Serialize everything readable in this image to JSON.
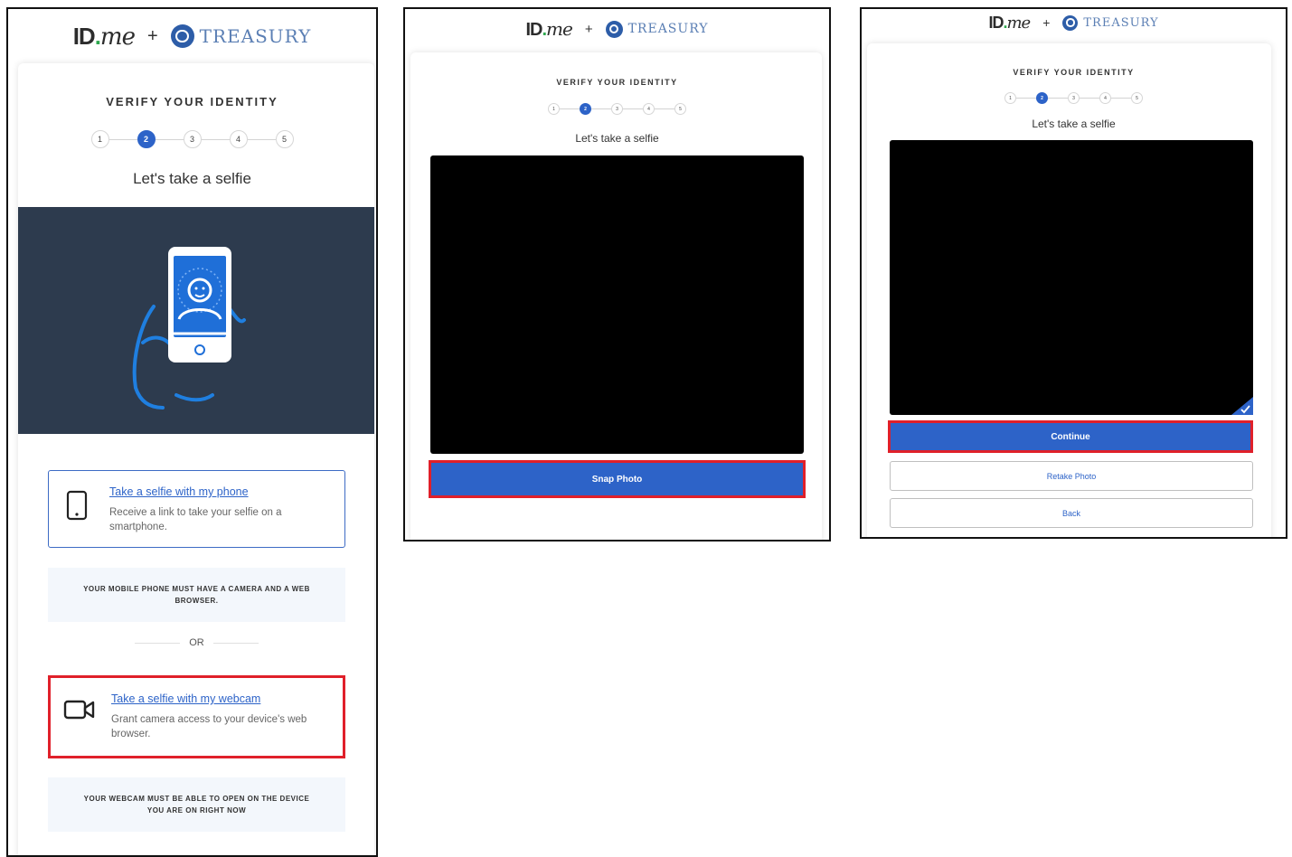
{
  "brand": {
    "idme_prefix": "ID",
    "idme_dot": ".",
    "idme_suffix": "me",
    "plus": "+",
    "partner": "TREASURY",
    "accent_color": "#2d63c8",
    "highlight_color": "#e0202a"
  },
  "panel1": {
    "title": "VERIFY YOUR IDENTITY",
    "steps": [
      "1",
      "2",
      "3",
      "4",
      "5"
    ],
    "active_step": "2",
    "subtitle": "Let's take a selfie",
    "hero_icon": "phone-selfie-illustration",
    "options": {
      "phone": {
        "icon": "smartphone-icon",
        "link": "Take a selfie with my phone",
        "description": "Receive a link to take your selfie on a smartphone."
      },
      "webcam": {
        "icon": "video-camera-icon",
        "link": "Take a selfie with my webcam",
        "description": "Grant camera access to your device's web browser."
      }
    },
    "phone_notice": "YOUR MOBILE PHONE MUST HAVE A CAMERA AND A WEB BROWSER.",
    "or": "OR",
    "webcam_notice": "YOUR WEBCAM MUST BE ABLE TO OPEN ON THE DEVICE YOU ARE ON RIGHT NOW"
  },
  "panel2": {
    "title": "VERIFY YOUR IDENTITY",
    "steps": [
      "1",
      "2",
      "3",
      "4",
      "5"
    ],
    "subtitle": "Let's take a selfie",
    "snap_button": "Snap Photo"
  },
  "panel3": {
    "title": "VERIFY YOUR IDENTITY",
    "steps": [
      "1",
      "2",
      "3",
      "4",
      "5"
    ],
    "subtitle": "Let's take a selfie",
    "continue_button": "Continue",
    "retake_button": "Retake Photo",
    "back_button": "Back"
  }
}
